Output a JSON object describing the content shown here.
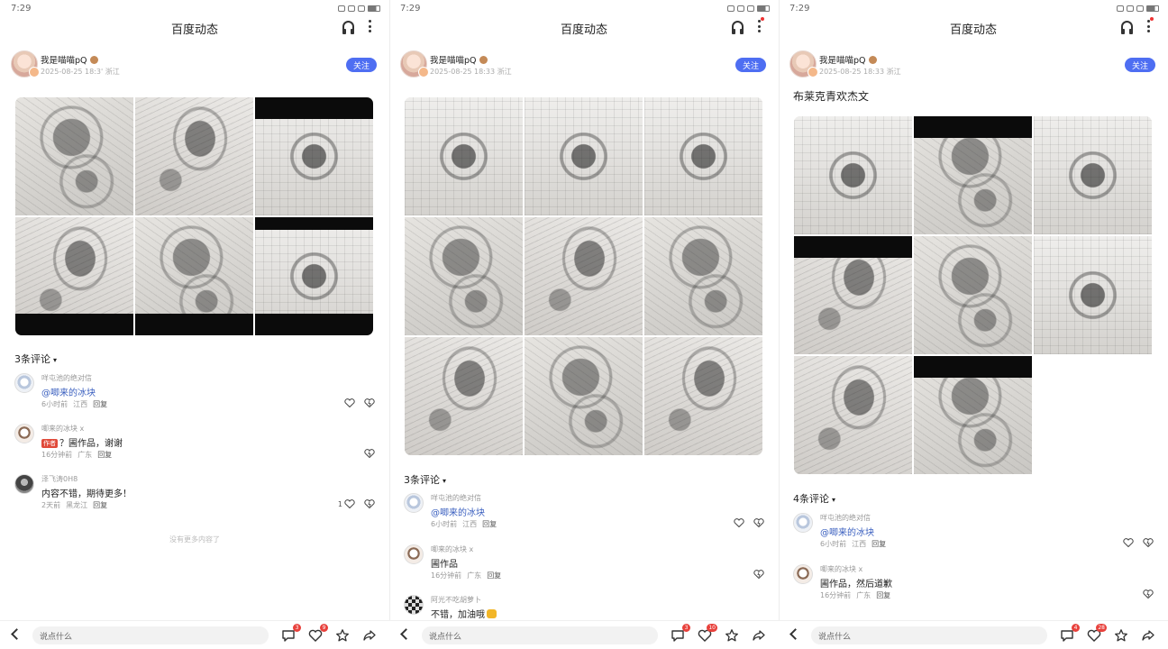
{
  "colors": {
    "accent": "#4e6ef2",
    "badge_red": "#e8413c",
    "mention_blue": "#3a5fbf"
  },
  "panels": [
    {
      "status_time": "7:29",
      "page_title": "百度动态",
      "author": {
        "name": "我是喵喵pQ",
        "meta": "2025-08-25 18:3' 浙江"
      },
      "follow_label": "关注",
      "post_text": "",
      "image_count": 6,
      "comments_header": "3条评论",
      "comments": [
        {
          "name": "咩屯池的绝对信",
          "text": "@唧来的冰块",
          "time": "6小时前",
          "loc": "江西",
          "reply": "回复",
          "likes": ""
        },
        {
          "name": "唧来的冰块 ⅹ",
          "tag": "作者",
          "text": "？圃作品，谢谢",
          "time": "16分钟前",
          "loc": "广东",
          "reply": "回复",
          "likes": ""
        },
        {
          "name": "泽飞涛0H8",
          "text": "内容不错，期待更多！",
          "time": "2天前",
          "loc": "黑龙江",
          "reply": "回复",
          "likes": "1"
        }
      ],
      "no_more": "没有更多内容了",
      "input_placeholder": "说点什么",
      "bottom_counts": {
        "comment": "3",
        "like": "9"
      }
    },
    {
      "status_time": "7:29",
      "page_title": "百度动态",
      "author": {
        "name": "我是喵喵pQ",
        "meta": "2025-08-25 18:33 浙江"
      },
      "follow_label": "关注",
      "post_text": "",
      "image_count": 9,
      "comments_header": "3条评论",
      "comments": [
        {
          "name": "咩屯池的绝对信",
          "text": "@唧来的冰块",
          "time": "6小时前",
          "loc": "江西",
          "reply": "回复",
          "likes": ""
        },
        {
          "name": "唧来的冰块 ⅹ",
          "text": "圃作品",
          "time": "16分钟前",
          "loc": "广东",
          "reply": "回复",
          "likes": ""
        },
        {
          "name": "阿光不吃胡萝卜",
          "text": "不错，加油哦",
          "time": "",
          "loc": "",
          "reply": "",
          "likes": "",
          "emoji": true
        }
      ],
      "no_more": "",
      "input_placeholder": "说点什么",
      "bottom_counts": {
        "comment": "3",
        "like": "10"
      }
    },
    {
      "status_time": "7:29",
      "page_title": "百度动态",
      "author": {
        "name": "我是喵喵pQ",
        "meta": "2025-08-25 18:33 浙江"
      },
      "follow_label": "关注",
      "post_text": "布莱克青欢杰文",
      "image_count": 8,
      "comments_header": "4条评论",
      "comments": [
        {
          "name": "咩屯池的绝对信",
          "text": "@唧来的冰块",
          "time": "6小时前",
          "loc": "江西",
          "reply": "回复",
          "likes": ""
        },
        {
          "name": "唧来的冰块 ⅹ",
          "text": "圃作品，然后道歉",
          "time": "16分钟前",
          "loc": "广东",
          "reply": "回复",
          "likes": ""
        }
      ],
      "no_more": "",
      "input_placeholder": "说点什么",
      "bottom_counts": {
        "comment": "4",
        "like": "28"
      }
    }
  ]
}
